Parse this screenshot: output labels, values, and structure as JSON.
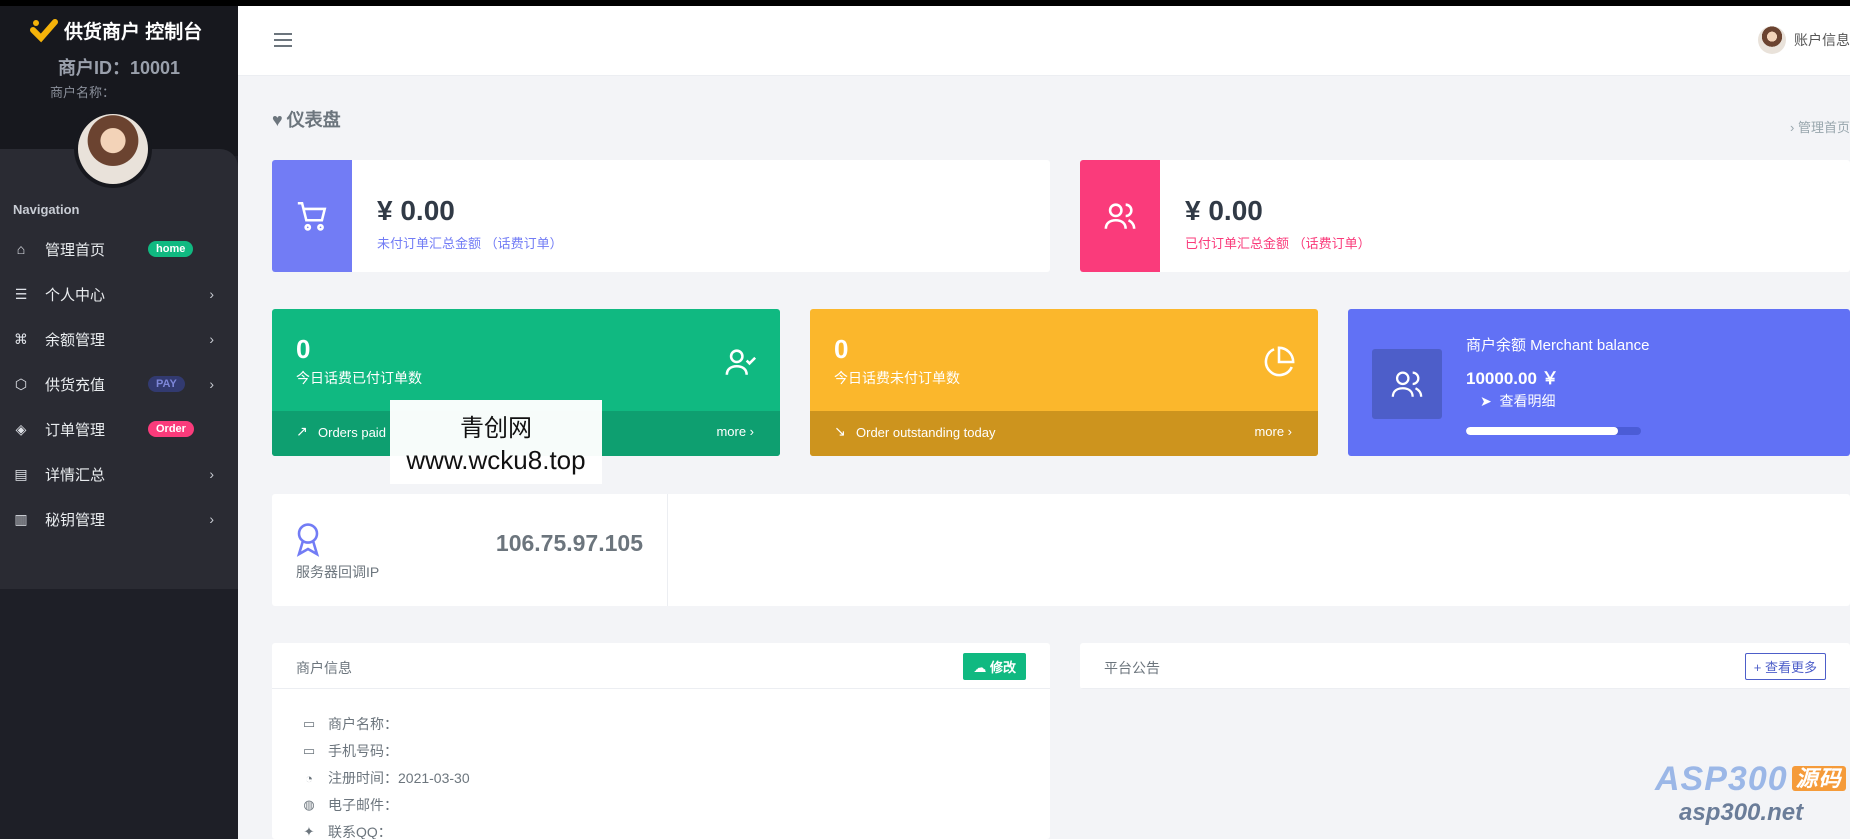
{
  "brand": {
    "title": "供货商户 控制台"
  },
  "merchant": {
    "id_label": "商户ID：10001",
    "name_label": "商户名称："
  },
  "nav": {
    "title": "Navigation",
    "items": [
      {
        "label": "管理首页",
        "icon": "home-icon",
        "badge": "home"
      },
      {
        "label": "个人中心",
        "icon": "list-icon"
      },
      {
        "label": "余额管理",
        "icon": "command-icon"
      },
      {
        "label": "供货充值",
        "icon": "box-icon",
        "badge": "PAY"
      },
      {
        "label": "订单管理",
        "icon": "layers-icon",
        "badge": "Order"
      },
      {
        "label": "详情汇总",
        "icon": "document-icon"
      },
      {
        "label": "秘钥管理",
        "icon": "map-icon"
      }
    ]
  },
  "topbar": {
    "account": "账户信息"
  },
  "page": {
    "title": "仪表盘",
    "breadcrumb": "› 管理首页"
  },
  "amount_cards": [
    {
      "value": "¥ 0.00",
      "label": "未付订单汇总金额 （话费订单）",
      "color": "#727cf5",
      "label_color": "#727cf5"
    },
    {
      "value": "¥ 0.00",
      "label": "已付订单汇总金额 （话费订单）",
      "color": "#fa3b7b",
      "label_color": "#fa3b7b"
    }
  ],
  "stat_cards": [
    {
      "number": "0",
      "label": "今日话费已付订单数",
      "footer": "Orders paid",
      "more": "more ›",
      "color": "#10b981",
      "foot_color": "#0e9f70"
    },
    {
      "number": "0",
      "label": "今日话费未付订单数",
      "footer": "Order outstanding today",
      "more": "more ›",
      "color": "#fbb72c",
      "foot_color": "#cd941e"
    }
  ],
  "balance": {
    "title": "商户余额 Merchant balance",
    "amount": "10000.00 ￥",
    "link": "查看明细",
    "progress": 0.87,
    "color": "#6171f5"
  },
  "server": {
    "ip": "106.75.97.105",
    "label": "服务器回调IP"
  },
  "merchant_panel": {
    "title": "商户信息",
    "edit": "修改",
    "rows": [
      {
        "label": "商户名称：",
        "icon": "monitor-icon"
      },
      {
        "label": "手机号码：",
        "icon": "monitor-icon"
      },
      {
        "label": "注册时间：2021-03-30",
        "icon": "clock-icon"
      },
      {
        "label": "电子邮件：",
        "icon": "globe-icon"
      },
      {
        "label": "联系QQ：",
        "icon": "twitter-icon"
      }
    ]
  },
  "notice_panel": {
    "title": "平台公告",
    "more": "+ 查看更多"
  },
  "watermark": {
    "line1": "青创网",
    "line2": "www.wcku8.top",
    "corner1": "ASP300",
    "corner_tag": "源码",
    "corner2": "asp300.net"
  }
}
